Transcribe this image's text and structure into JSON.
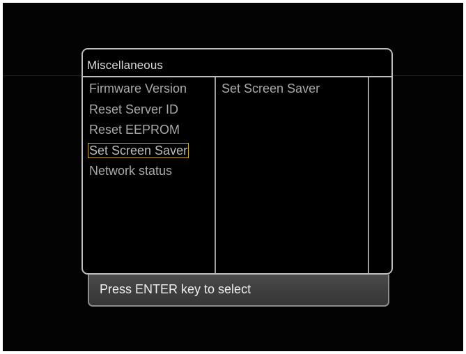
{
  "panel": {
    "title": "Miscellaneous"
  },
  "menu": {
    "items": [
      {
        "label": "Firmware Version"
      },
      {
        "label": "Reset Server ID"
      },
      {
        "label": "Reset EEPROM"
      },
      {
        "label": "Set Screen Saver",
        "selected": true
      },
      {
        "label": "Network status"
      }
    ]
  },
  "detail": {
    "text": "Set Screen Saver"
  },
  "status": {
    "hint": "Press ENTER key to select"
  },
  "colors": {
    "background": "#030303",
    "border": "#bdbdbd",
    "text": "#a9a9a9",
    "selection_outline": "#c8ae2c",
    "status_bar": "#404040"
  }
}
